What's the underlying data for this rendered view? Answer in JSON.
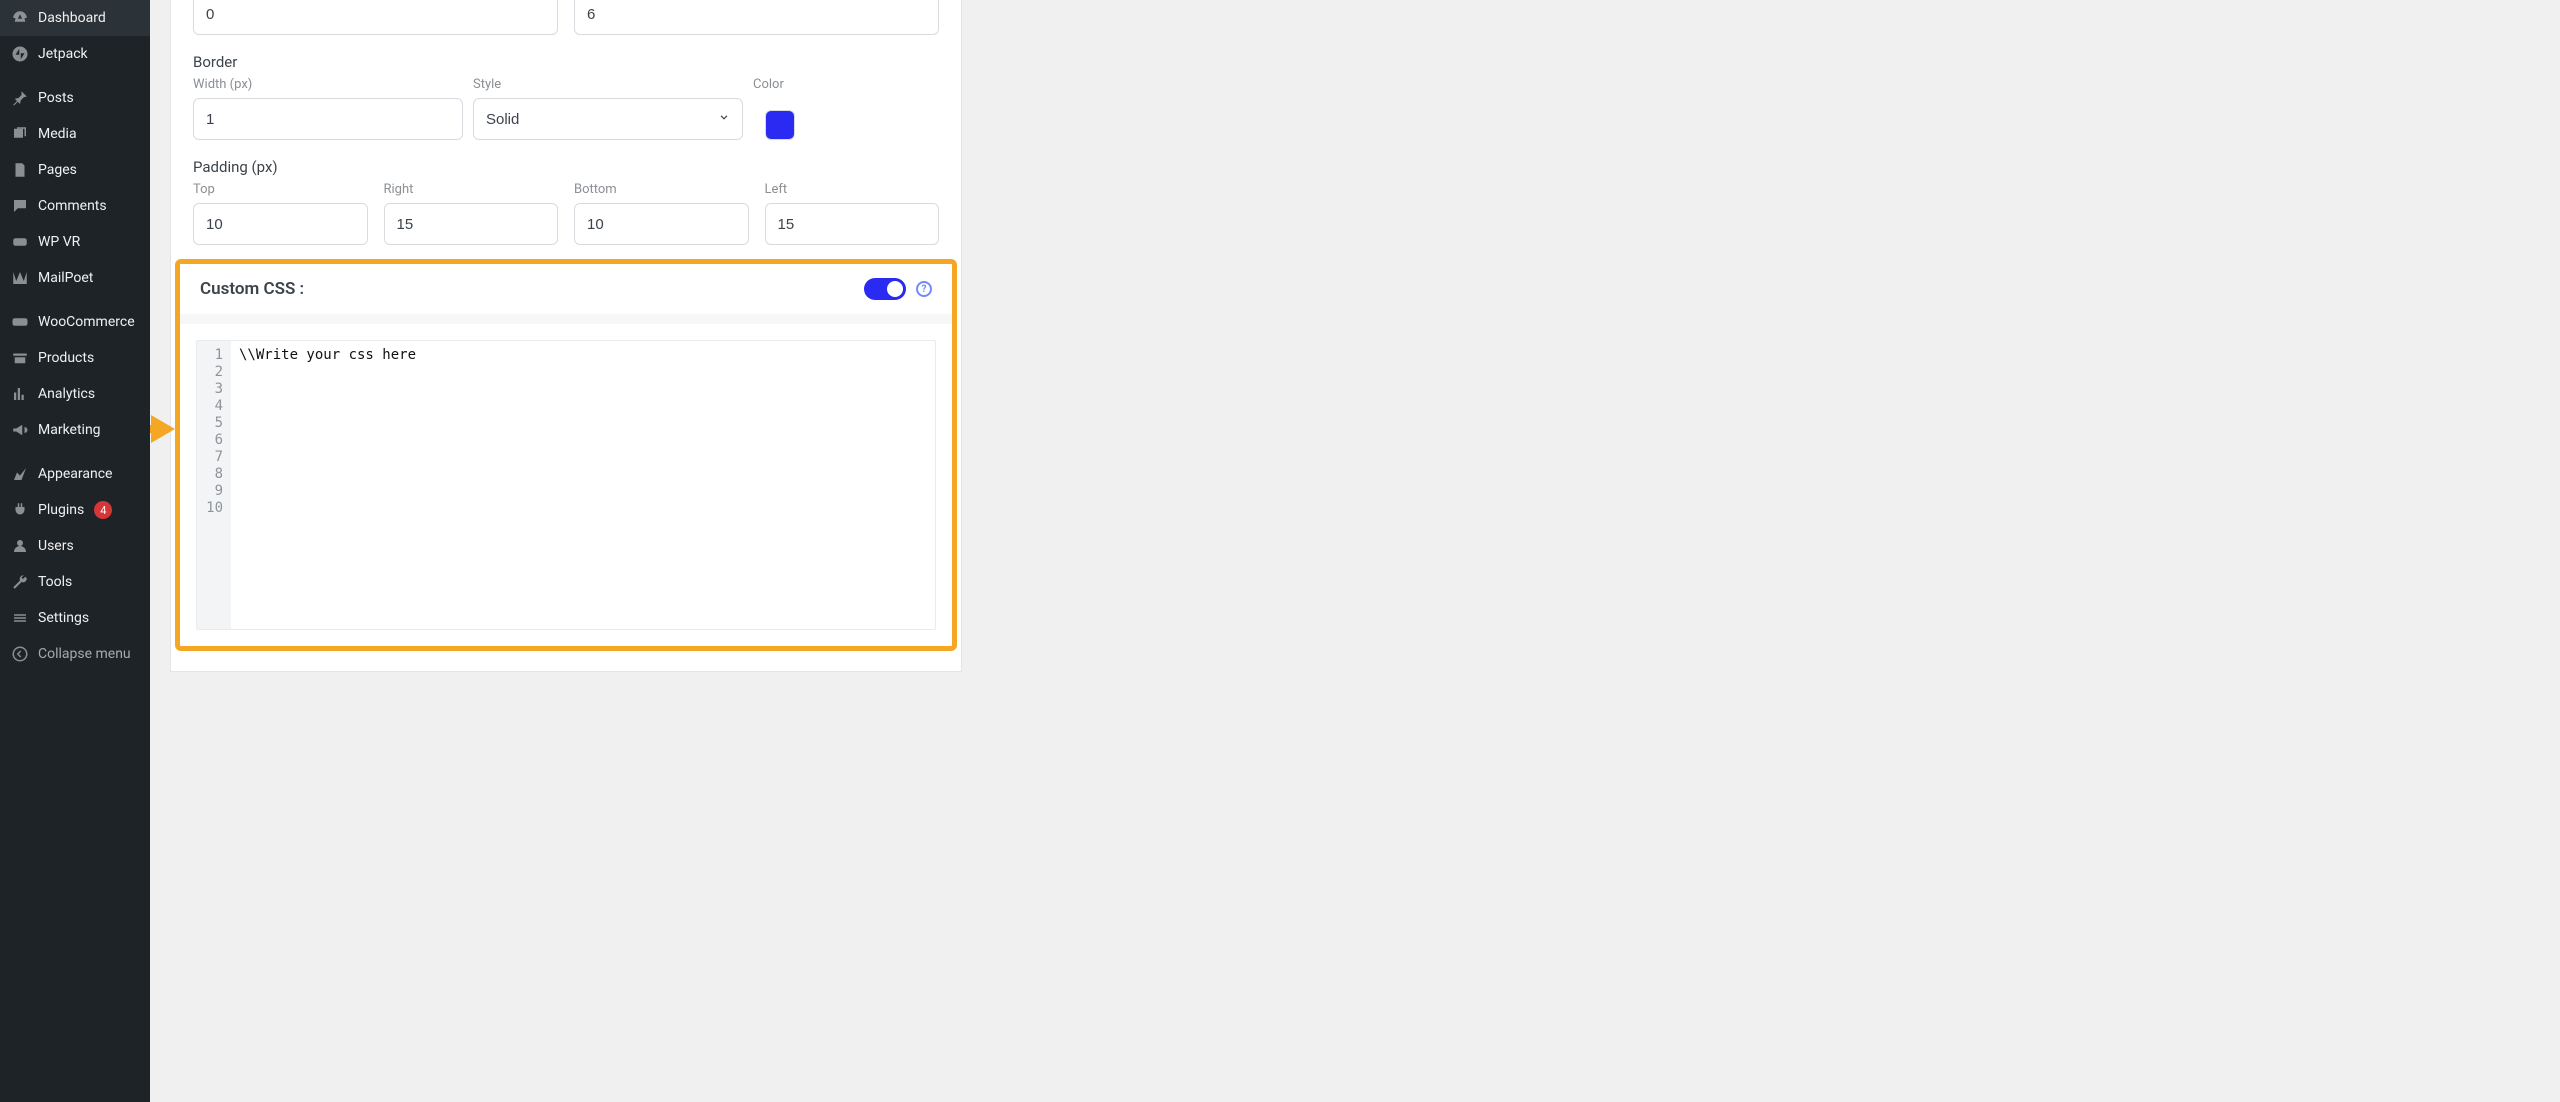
{
  "sidebar": {
    "items": [
      {
        "label": "Dashboard",
        "icon": "dashboard-icon"
      },
      {
        "label": "Jetpack",
        "icon": "jetpack-icon"
      },
      {
        "label": "Posts",
        "icon": "pin-icon"
      },
      {
        "label": "Media",
        "icon": "media-icon"
      },
      {
        "label": "Pages",
        "icon": "pages-icon"
      },
      {
        "label": "Comments",
        "icon": "comments-icon"
      },
      {
        "label": "WP VR",
        "icon": "wpvr-icon"
      },
      {
        "label": "MailPoet",
        "icon": "mailpoet-icon"
      },
      {
        "label": "WooCommerce",
        "icon": "woo-icon"
      },
      {
        "label": "Products",
        "icon": "products-icon"
      },
      {
        "label": "Analytics",
        "icon": "analytics-icon"
      },
      {
        "label": "Marketing",
        "icon": "marketing-icon"
      },
      {
        "label": "Appearance",
        "icon": "appearance-icon"
      },
      {
        "label": "Plugins",
        "icon": "plugins-icon",
        "badge": "4"
      },
      {
        "label": "Users",
        "icon": "users-icon"
      },
      {
        "label": "Tools",
        "icon": "tools-icon"
      },
      {
        "label": "Settings",
        "icon": "settings-icon"
      }
    ],
    "collapse_label": "Collapse menu"
  },
  "form": {
    "rowA": {
      "left": "0",
      "right": "6"
    },
    "border_label": "Border",
    "border_width_label": "Width (px)",
    "border_width_value": "1",
    "border_style_label": "Style",
    "border_style_value": "Solid",
    "border_color_label": "Color",
    "border_color_hex": "#2a2af3",
    "padding_label": "Padding (px)",
    "padding": {
      "top_label": "Top",
      "top_value": "10",
      "right_label": "Right",
      "right_value": "15",
      "bottom_label": "Bottom",
      "bottom_value": "10",
      "left_label": "Left",
      "left_value": "15"
    },
    "custom_css": {
      "title": "Custom CSS :",
      "toggle_on": true,
      "editor_line_count": 10,
      "editor_content": "\\\\Write your css here"
    }
  },
  "colors": {
    "highlight": "#f5a623",
    "accent": "#2a2af3"
  }
}
